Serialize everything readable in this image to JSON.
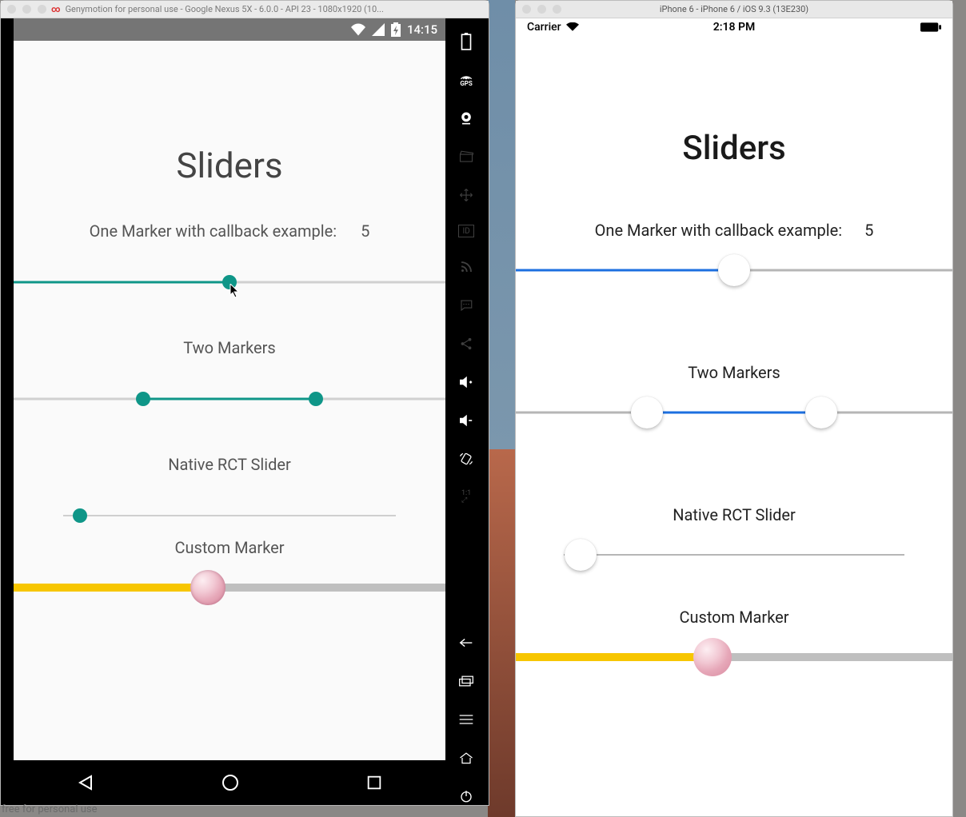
{
  "android": {
    "window_title": "Genymotion for personal use - Google Nexus 5X - 6.0.0 - API 23 - 1080x1920 (10...",
    "status": {
      "time": "14:15"
    },
    "title": "Sliders",
    "one_marker_label": "One Marker with callback example:",
    "one_marker_value": "5",
    "two_markers_label": "Two Markers",
    "native_label": "Native RCT Slider",
    "custom_label": "Custom Marker",
    "side_icons": [
      "battery",
      "gps",
      "camera",
      "clapper",
      "move",
      "id",
      "rss",
      "sms",
      "share",
      "vol-up",
      "vol-down",
      "rotate",
      "scale",
      "spacer",
      "back",
      "multitask",
      "tasks",
      "home",
      "power"
    ],
    "sliders": {
      "one": {
        "fill_pct": 50,
        "thumb_pct": 50
      },
      "two": {
        "low_pct": 30,
        "high_pct": 70
      },
      "native": {
        "thumb_pct": 5
      },
      "custom": {
        "fill_pct": 45,
        "thumb_pct": 45
      }
    }
  },
  "ios": {
    "window_title": "iPhone 6 - iPhone 6 / iOS 9.3 (13E230)",
    "status": {
      "carrier": "Carrier",
      "time": "2:18 PM"
    },
    "title": "Sliders",
    "one_marker_label": "One Marker with callback example:",
    "one_marker_value": "5",
    "two_markers_label": "Two Markers",
    "native_label": "Native RCT Slider",
    "custom_label": "Custom Marker",
    "sliders": {
      "one": {
        "fill_pct": 50,
        "thumb_pct": 50
      },
      "two": {
        "low_pct": 30,
        "high_pct": 70
      },
      "native": {
        "thumb_pct": 5
      },
      "custom": {
        "fill_pct": 45,
        "thumb_pct": 45
      }
    }
  },
  "watermark": "free for personal use",
  "colors": {
    "android_accent": "#0f9688",
    "ios_accent": "#1c6fe0",
    "custom_fill": "#f7c600"
  }
}
